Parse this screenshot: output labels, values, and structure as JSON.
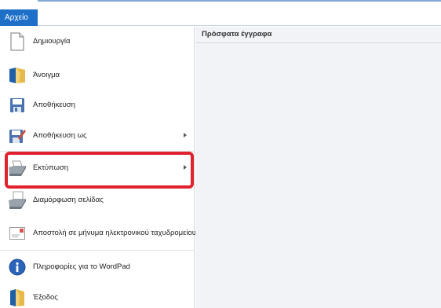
{
  "ribbon": {
    "file_tab": "Αρχείο"
  },
  "menu": {
    "items": [
      {
        "label": "Δημιουργία"
      },
      {
        "label": "Άνοιγμα"
      },
      {
        "label": "Αποθήκευση"
      },
      {
        "label": "Αποθήκευση ως"
      },
      {
        "label": "Εκτύπωση"
      },
      {
        "label": "Διαμόρφωση σελίδας"
      },
      {
        "label": "Αποστολή σε μήνυμα ηλεκτρονικού ταχυδρομείου"
      },
      {
        "label": "Πληροφορίες για το WordPad"
      },
      {
        "label": "Έξοδος"
      }
    ]
  },
  "recent": {
    "header": "Πρόσφατα έγγραφα"
  },
  "colors": {
    "accent": "#1e6fc8",
    "highlight": "#e0222e"
  }
}
